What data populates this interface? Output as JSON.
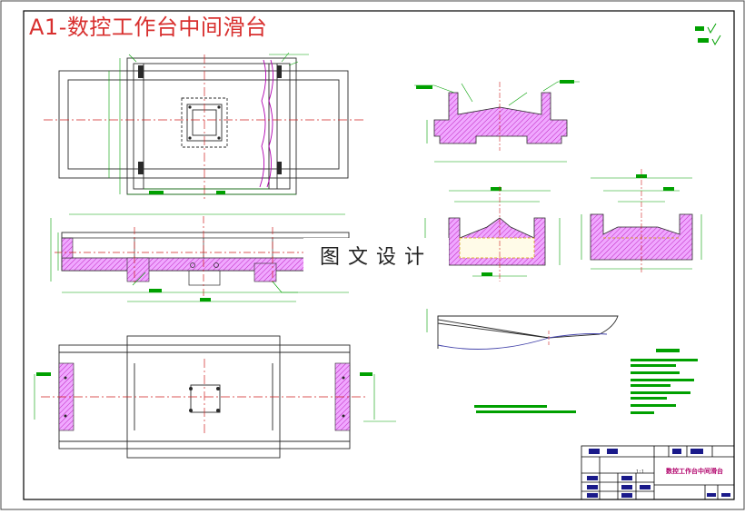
{
  "drawing": {
    "title": "A1-数控工作台中间滑台",
    "watermark": "图文设计",
    "titleblock_name": "数控工作台中间滑台",
    "scale": "1:1"
  },
  "colors": {
    "border": "#000000",
    "outline": "#2a2a2a",
    "dimension": "#00a000",
    "centerline": "#d02020",
    "section_fill": "#f0a8ff",
    "hatch": "#b000b0",
    "hidden_line": "#d0a000",
    "note_text": "#00a000",
    "title_red": "#d8302f"
  }
}
